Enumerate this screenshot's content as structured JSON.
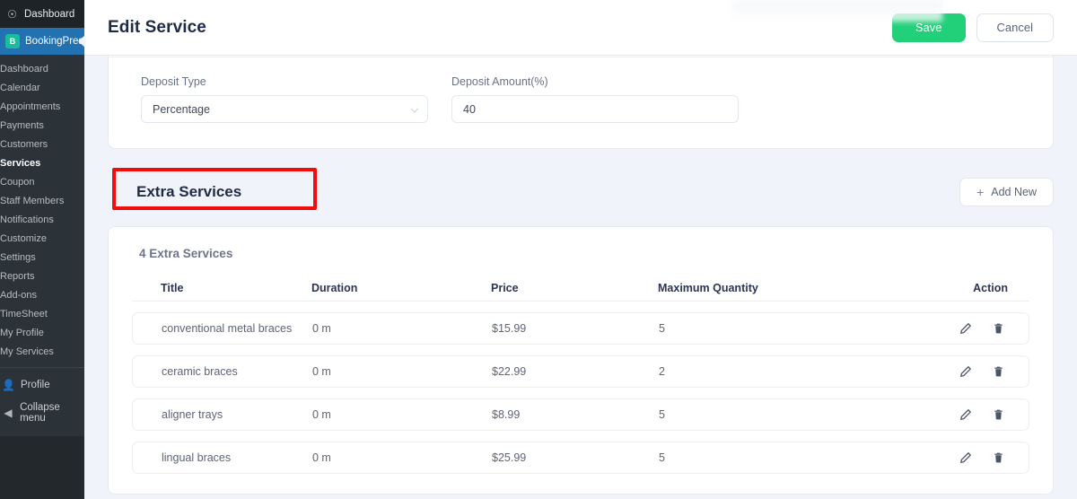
{
  "wp_sidebar": {
    "adminbar": {
      "label": "Dashboard",
      "icon": "wordpress-icon"
    },
    "plugin": {
      "label": "BookingPress",
      "icon": "bookingpress-icon",
      "badge": "B"
    },
    "items": [
      {
        "label": "Dashboard",
        "current": false
      },
      {
        "label": "Calendar",
        "current": false
      },
      {
        "label": "Appointments",
        "current": false
      },
      {
        "label": "Payments",
        "current": false
      },
      {
        "label": "Customers",
        "current": false
      },
      {
        "label": "Services",
        "current": true
      },
      {
        "label": "Coupon",
        "current": false
      },
      {
        "label": "Staff Members",
        "current": false
      },
      {
        "label": "Notifications",
        "current": false
      },
      {
        "label": "Customize",
        "current": false
      },
      {
        "label": "Settings",
        "current": false
      },
      {
        "label": "Reports",
        "current": false
      },
      {
        "label": "Add-ons",
        "current": false
      },
      {
        "label": "TimeSheet",
        "current": false
      },
      {
        "label": "My Profile",
        "current": false
      },
      {
        "label": "My Services",
        "current": false
      }
    ],
    "bottom": [
      {
        "label": "Profile",
        "icon": "user-icon"
      },
      {
        "label": "Collapse menu",
        "icon": "collapse-icon"
      }
    ]
  },
  "topbar": {
    "title": "Edit Service",
    "save_label": "Save",
    "cancel_label": "Cancel",
    "save_color": "#23d07a"
  },
  "deposit": {
    "type_label": "Deposit Type",
    "type_value": "Percentage",
    "amount_label": "Deposit Amount(%)",
    "amount_value": "40"
  },
  "extra_services": {
    "section_title": "Extra Services",
    "add_new_label": "Add New",
    "count_label": "4 Extra Services",
    "annotation_color": "#f20d0d",
    "columns": [
      "Title",
      "Duration",
      "Price",
      "Maximum Quantity",
      "Action"
    ],
    "rows": [
      {
        "title": "conventional metal braces",
        "duration": "0 m",
        "price": "$15.99",
        "max_quantity": "5"
      },
      {
        "title": "ceramic braces",
        "duration": "0 m",
        "price": "$22.99",
        "max_quantity": "2"
      },
      {
        "title": "aligner trays",
        "duration": "0 m",
        "price": "$8.99",
        "max_quantity": "5"
      },
      {
        "title": "lingual braces",
        "duration": "0 m",
        "price": "$25.99",
        "max_quantity": "5"
      }
    ]
  }
}
